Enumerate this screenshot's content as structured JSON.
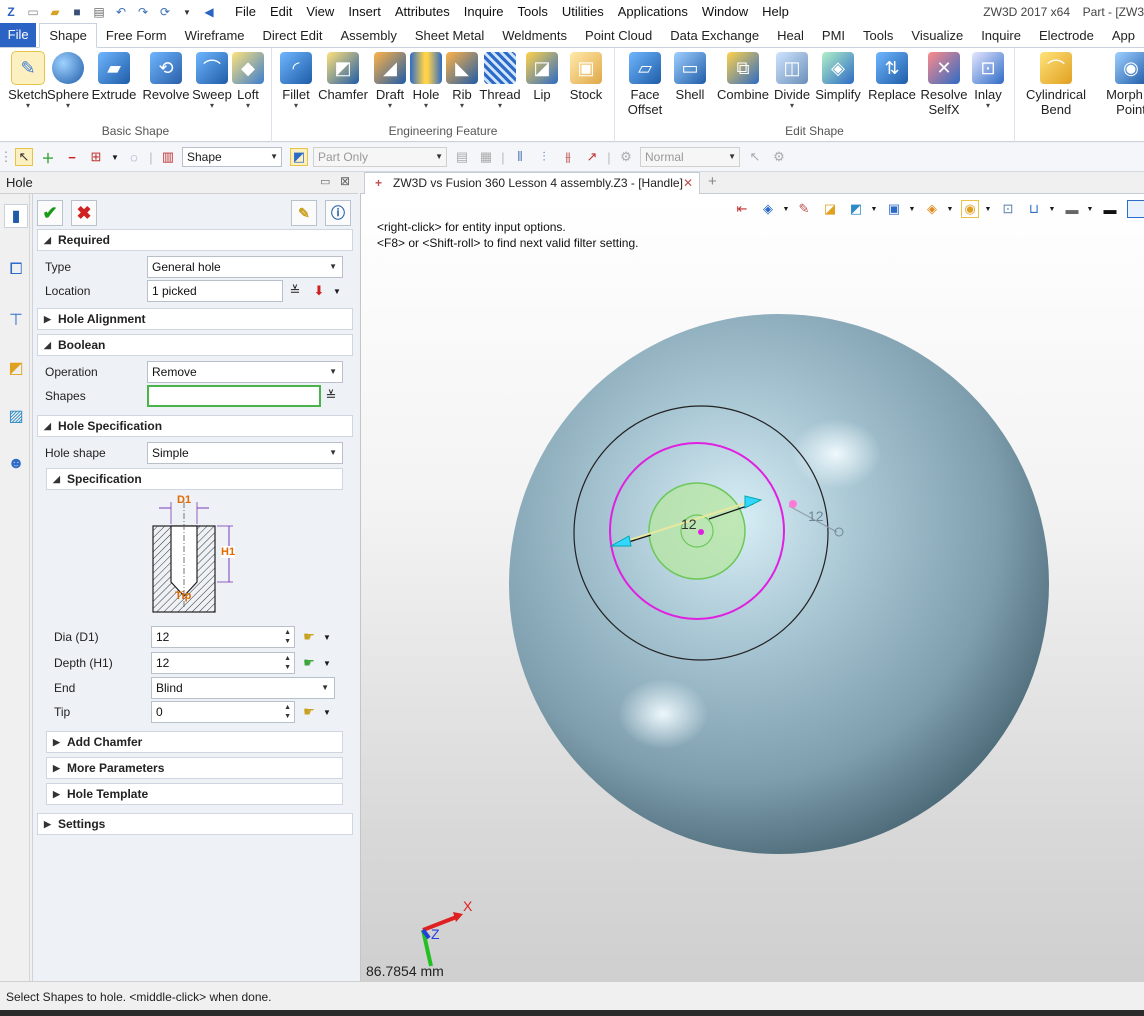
{
  "title_bar": {
    "menus": [
      "File",
      "Edit",
      "View",
      "Insert",
      "Attributes",
      "Inquire",
      "Tools",
      "Utilities",
      "Applications",
      "Window",
      "Help"
    ],
    "app_title": "ZW3D 2017  x64",
    "doc_title": "Part - [ZW3"
  },
  "ribbon_tabs": [
    "File",
    "Shape",
    "Free Form",
    "Wireframe",
    "Direct Edit",
    "Assembly",
    "Sheet Metal",
    "Weldments",
    "Point Cloud",
    "Data Exchange",
    "Heal",
    "PMI",
    "Tools",
    "Visualize",
    "Inquire",
    "Electrode",
    "App"
  ],
  "ribbon_groups": {
    "basic_shape": {
      "label": "Basic Shape",
      "buttons": [
        "Sketch",
        "Sphere",
        "Extrude",
        "Revolve",
        "Sweep",
        "Loft"
      ]
    },
    "engineering_feature": {
      "label": "Engineering Feature",
      "buttons": [
        "Fillet",
        "Chamfer",
        "Draft",
        "Hole",
        "Rib",
        "Thread",
        "Lip",
        "Stock"
      ]
    },
    "edit_shape": {
      "label": "Edit Shape",
      "buttons": [
        "Face\nOffset",
        "Shell",
        "Combine",
        "Divide",
        "Simplify",
        "Replace",
        "Resolve\nSelfX",
        "Inlay"
      ]
    },
    "extra": {
      "buttons": [
        "Cylindrical\nBend",
        "Morph w\nPoint"
      ]
    }
  },
  "toolbar": {
    "filter_combo": "Shape",
    "part_combo": "Part Only",
    "normal_combo": "Normal"
  },
  "panel": {
    "title": "Hole",
    "required": {
      "header": "Required",
      "type_label": "Type",
      "type_value": "General hole",
      "location_label": "Location",
      "location_value": "1 picked"
    },
    "hole_alignment": "Hole Alignment",
    "boolean": {
      "header": "Boolean",
      "operation_label": "Operation",
      "operation_value": "Remove",
      "shapes_label": "Shapes",
      "shapes_value": ""
    },
    "hole_specification": {
      "header": "Hole Specification",
      "hole_shape_label": "Hole shape",
      "hole_shape_value": "Simple",
      "specification_header": "Specification",
      "diagram_labels": {
        "d1": "D1",
        "h1": "H1",
        "tip": "Tip"
      },
      "dia_label": "Dia (D1)",
      "dia_value": "12",
      "depth_label": "Depth (H1)",
      "depth_value": "12",
      "end_label": "End",
      "end_value": "Blind",
      "tip_label": "Tip",
      "tip_value": "0",
      "add_chamfer": "Add Chamfer",
      "more_parameters": "More Parameters",
      "hole_template": "Hole Template"
    },
    "settings": "Settings"
  },
  "viewport": {
    "tab_title": "ZW3D vs Fusion 360 Lesson 4 assembly.Z3 - [Handle]",
    "prompt_line1": "<right-click> for entity input options.",
    "prompt_line2": "<F8> or <Shift-roll> to find next valid filter setting.",
    "dim_label_a": "12",
    "dim_label_b": "12",
    "axis_x": "X",
    "axis_z": "Z",
    "scale_readout": "86.7854 mm"
  },
  "status": {
    "text": "Select Shapes to hole.  <middle-click> when done."
  },
  "colors": {
    "file_tab": "#2b63c4",
    "sphere": "#9bb8c6",
    "hole_preview": "#b7e6a2",
    "magenta_circle": "#e020e0",
    "ok_check": "#1a9a1a",
    "cancel_x": "#d02020"
  }
}
